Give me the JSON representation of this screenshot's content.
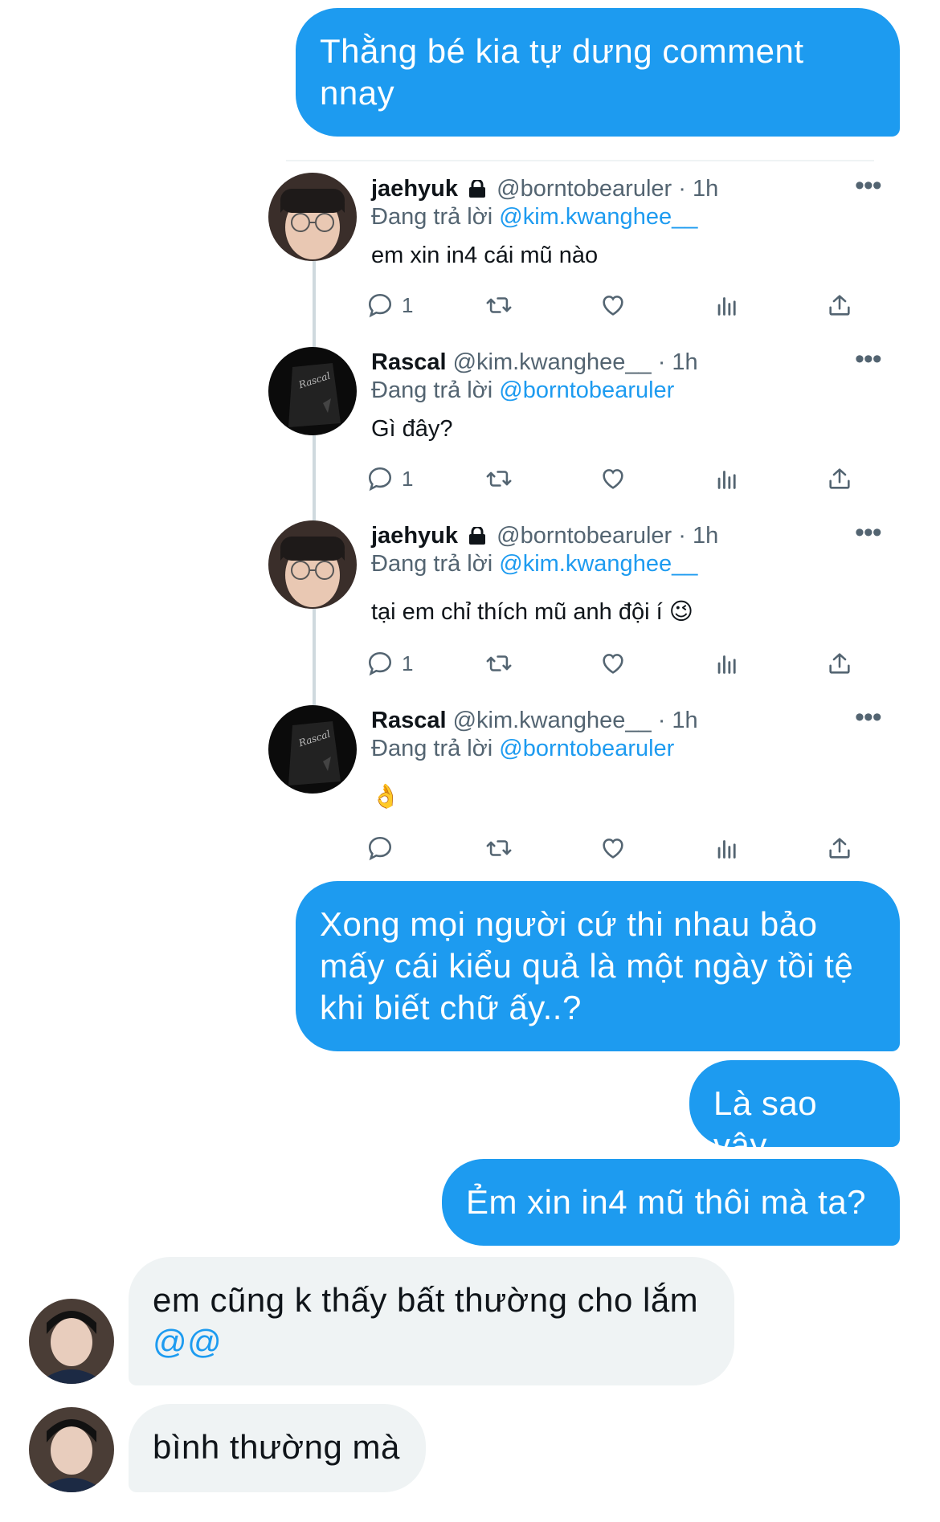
{
  "messages_top": {
    "m1": "Thằng bé kia tự dưng comment nnay"
  },
  "tweets": [
    {
      "name": "jaehyuk",
      "handle": "@borntobearuler · 1h",
      "reply_prefix": "Đang trả lời",
      "reply_to": "@kim.kwanghee__",
      "text": "em xin in4 cái mũ nào",
      "reply_count": "1",
      "locked": true
    },
    {
      "name": "Rascal",
      "handle": "@kim.kwanghee__ · 1h",
      "reply_prefix": "Đang trả lời",
      "reply_to": "@borntobearuler",
      "text": "Gì đây?",
      "reply_count": "1",
      "locked": false
    },
    {
      "name": "jaehyuk",
      "handle": "@borntobearuler · 1h",
      "reply_prefix": "Đang trả lời",
      "reply_to": "@kim.kwanghee__",
      "text": "tại em chỉ thích mũ anh đội í 😉",
      "reply_count": "1",
      "locked": true
    },
    {
      "name": "Rascal",
      "handle": "@kim.kwanghee__ · 1h",
      "reply_prefix": "Đang trả lời",
      "reply_to": "@borntobearuler",
      "text": "👌",
      "reply_count": "",
      "locked": false
    }
  ],
  "messages_bottom": {
    "m2": "Xong mọi người cứ thi nhau bảo mấy cái kiểu quả là một ngày tồi tệ khi biết chữ ấy..?",
    "m3": "Là sao vậy",
    "m4": "Ẻm xin in4 mũ thôi mà ta?",
    "m5_text": "em cũng k thấy bất thường cho lắm",
    "m5_mention": "@@",
    "m6": "bình thường mà"
  },
  "colors": {
    "accent": "#1d9bf0",
    "incoming_bg": "#eff3f4",
    "muted": "#536471"
  },
  "icons": [
    "reply-icon",
    "retweet-icon",
    "like-icon",
    "analytics-icon",
    "share-icon",
    "more-icon",
    "lock-icon"
  ]
}
